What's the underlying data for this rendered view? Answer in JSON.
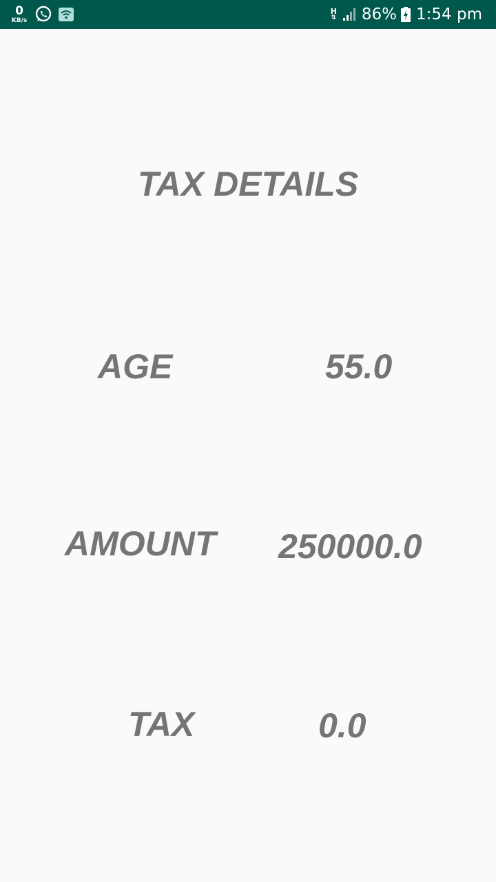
{
  "status_bar": {
    "speed_value": "0",
    "speed_unit": "KB/s",
    "network_type": "H",
    "network_arrows": "⇅",
    "battery": "86%",
    "time": "1:54 pm",
    "icons": [
      "whatsapp-icon",
      "screenshot-icon",
      "signal-icon",
      "battery-charging-icon"
    ],
    "background_color": "#00574b"
  },
  "page": {
    "title": "TAX DETAILS",
    "text_color": "#757575",
    "background_color": "#fafafa",
    "rows": [
      {
        "label": "AGE",
        "value": "55.0"
      },
      {
        "label": "AMOUNT",
        "value": "250000.0"
      },
      {
        "label": "TAX",
        "value": "0.0"
      }
    ]
  }
}
